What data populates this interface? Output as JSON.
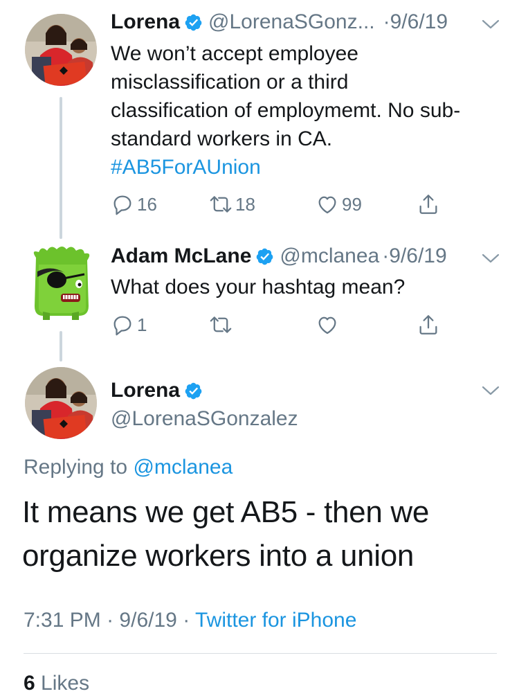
{
  "tweet1": {
    "name": "Lorena",
    "handle": "@LorenaSGonz...",
    "dot": "·",
    "date": "9/6/19",
    "text_lines": [
      "We won’t accept employee",
      "misclassification or a third",
      "classification of employmemt. No sub-",
      "standard workers in CA."
    ],
    "hashtag": "#AB5ForAUnion",
    "reply_count": "16",
    "retweet_count": "18",
    "like_count": "99"
  },
  "tweet2": {
    "name": "Adam McLane",
    "handle": "@mclanea",
    "dot": "·",
    "date": "9/6/19",
    "text": "What does your hashtag mean?",
    "reply_count": "1",
    "retweet_count": "",
    "like_count": ""
  },
  "main": {
    "name": "Lorena",
    "handle": "@LorenaSGonzalez",
    "replying_prefix": "Replying to",
    "replying_mention": "@mclanea",
    "text_lines": [
      "It means we get AB5 - then we",
      "organize workers into a union"
    ],
    "time": "7:31 PM",
    "dot1": "·",
    "date": "9/6/19",
    "dot2": "·",
    "source": "Twitter for iPhone",
    "likes_count": "6",
    "likes_label": "Likes"
  },
  "colors": {
    "link": "#1b95e0",
    "muted": "#657786",
    "text": "#14171a",
    "thread_line": "#ccd6dd",
    "verified": "#1da1f2"
  },
  "icons": [
    "verified-badge-icon",
    "chevron-down-icon",
    "reply-icon",
    "retweet-icon",
    "like-icon",
    "share-icon"
  ]
}
